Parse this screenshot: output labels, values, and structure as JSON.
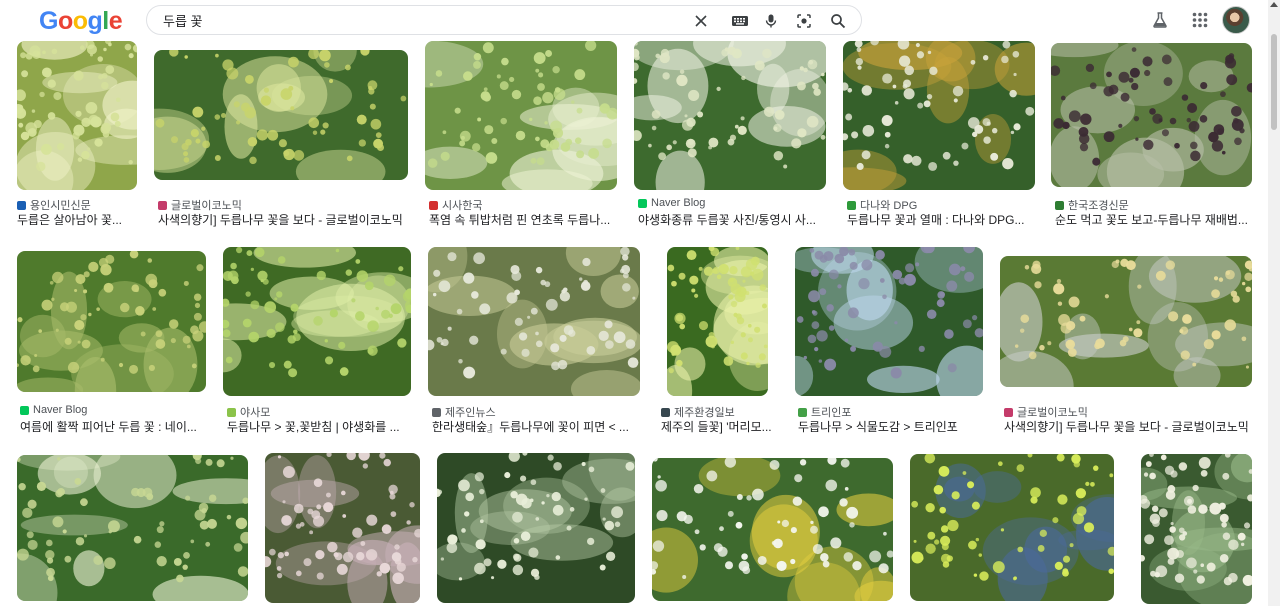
{
  "logo": {
    "letters": [
      "G",
      "o",
      "o",
      "g",
      "l",
      "e"
    ],
    "colors": [
      "#4285F4",
      "#EA4335",
      "#FBBC05",
      "#4285F4",
      "#34A853",
      "#EA4335"
    ]
  },
  "search": {
    "query": "두릅 꽃"
  },
  "icons": {
    "clear": "close-icon",
    "keyboard": "keyboard-icon",
    "voice": "microphone-icon",
    "lens": "lens-icon",
    "search": "search-icon",
    "labs": "flask-icon",
    "apps": "grid-icon"
  },
  "results": [
    {
      "source": "용인시민신문",
      "title": "두릅은 살아남아 꽃...",
      "favicon": "#1a5fb4",
      "palette": [
        "#d6e29a",
        "#8fa64a",
        "#f0f2c8"
      ]
    },
    {
      "source": "글로벌이코노믹",
      "title": "사색의향기] 두릅나무 꽃을 보다 - 글로벌이코노믹",
      "favicon": "#c43b6a",
      "palette": [
        "#c8d46a",
        "#3f6a2c",
        "#dfe8a0"
      ]
    },
    {
      "source": "시사한국",
      "title": "폭염 속 튀밥처럼 핀 연초록 두릅나...",
      "favicon": "#d32f2f",
      "palette": [
        "#c6dd8c",
        "#6e9446",
        "#eef3d6"
      ]
    },
    {
      "source": "Naver Blog",
      "title": "야생화종류 두릅꽃 사진/통영시 사...",
      "favicon": "#03c75a",
      "palette": [
        "#dfe6c4",
        "#3d6a2e",
        "#f4f6e8"
      ]
    },
    {
      "source": "다나와 DPG",
      "title": "두릅나무 꽃과 열매 : 다나와 DPG...",
      "favicon": "#2e9a3a",
      "palette": [
        "#e8ead8",
        "#35602a",
        "#c9a23a"
      ]
    },
    {
      "source": "한국조경신문",
      "title": "순도 먹고 꽃도 보고-두릅나무 재배법...",
      "favicon": "#2e7d32",
      "palette": [
        "#3b2a33",
        "#5b7a3e",
        "#b8c0a8"
      ]
    },
    {
      "source": "Naver Blog",
      "title": "여름에 활짝 피어난 두릅 꽃 : 네이...",
      "favicon": "#03c75a",
      "palette": [
        "#c8d27a",
        "#4f7a2c",
        "#a8bc6a"
      ]
    },
    {
      "source": "야사모",
      "title": "두릅나무 > 꽃,꽃받침 | 야생화를 ...",
      "favicon": "#8bc34a",
      "palette": [
        "#b4d46a",
        "#3f6a24",
        "#e0eea8"
      ]
    },
    {
      "source": "제주인뉴스",
      "title": "한라생태숲』두릅나무에 꽃이 피면 < ...",
      "favicon": "#5f6368",
      "palette": [
        "#e6e8da",
        "#6a7a4a",
        "#c8cc98"
      ]
    },
    {
      "source": "제주환경일보",
      "title": "제주의 들꽃] '머리모...",
      "favicon": "#37474f",
      "palette": [
        "#d0e070",
        "#3a6a20",
        "#e8f0a8"
      ]
    },
    {
      "source": "트리인포",
      "title": "두릅나무 > 식물도감 > 트리인포",
      "favicon": "#43a047",
      "palette": [
        "#8a8aa8",
        "#2f5a2a",
        "#bcd6ec"
      ]
    },
    {
      "source": "글로벌이코노믹",
      "title": "사색의향기] 두릅나무 꽃을 보다 - 글로벌이코노믹",
      "favicon": "#c43b6a",
      "palette": [
        "#e8dc9a",
        "#5a7a34",
        "#c8ccc8"
      ]
    },
    {
      "source": "",
      "title": "",
      "favicon": "#ffffff",
      "palette": [
        "#c8d894",
        "#3a6a2a",
        "#e8efd0"
      ]
    },
    {
      "source": "",
      "title": "",
      "favicon": "#ffffff",
      "palette": [
        "#e8d8d8",
        "#4a5a34",
        "#c8b0b8"
      ]
    },
    {
      "source": "",
      "title": "",
      "favicon": "#ffffff",
      "palette": [
        "#e8eed8",
        "#2e4a26",
        "#b8cca8"
      ]
    },
    {
      "source": "",
      "title": "",
      "favicon": "#ffffff",
      "palette": [
        "#f4f6ee",
        "#3e6a2e",
        "#e8d040"
      ]
    },
    {
      "source": "",
      "title": "",
      "favicon": "#ffffff",
      "palette": [
        "#d8ec5a",
        "#4a6a2a",
        "#4a6a9a"
      ]
    },
    {
      "source": "",
      "title": "",
      "favicon": "#ffffff",
      "palette": [
        "#f0f0e0",
        "#3a5a30",
        "#9aba8a"
      ]
    }
  ]
}
